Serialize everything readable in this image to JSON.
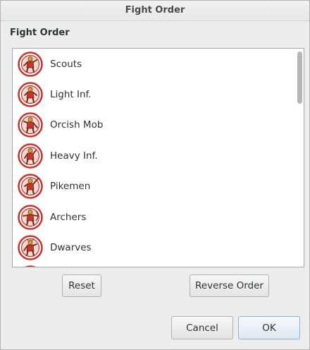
{
  "window": {
    "title": "Fight Order"
  },
  "section": {
    "label": "Fight Order"
  },
  "units": [
    {
      "label": "Scouts",
      "icon": "scout-unit-icon"
    },
    {
      "label": "Light Inf.",
      "icon": "light-infantry-unit-icon"
    },
    {
      "label": "Orcish Mob",
      "icon": "orcish-mob-unit-icon"
    },
    {
      "label": "Heavy Inf.",
      "icon": "heavy-infantry-unit-icon"
    },
    {
      "label": "Pikemen",
      "icon": "pikemen-unit-icon"
    },
    {
      "label": "Archers",
      "icon": "archers-unit-icon"
    },
    {
      "label": "Dwarves",
      "icon": "dwarves-unit-icon"
    }
  ],
  "buttons": {
    "reset": "Reset",
    "reverse": "Reverse Order",
    "cancel": "Cancel",
    "ok": "OK"
  },
  "colors": {
    "icon_ring": "#c8342b",
    "icon_figure": "#6b2a14",
    "icon_accent": "#e0a020"
  }
}
